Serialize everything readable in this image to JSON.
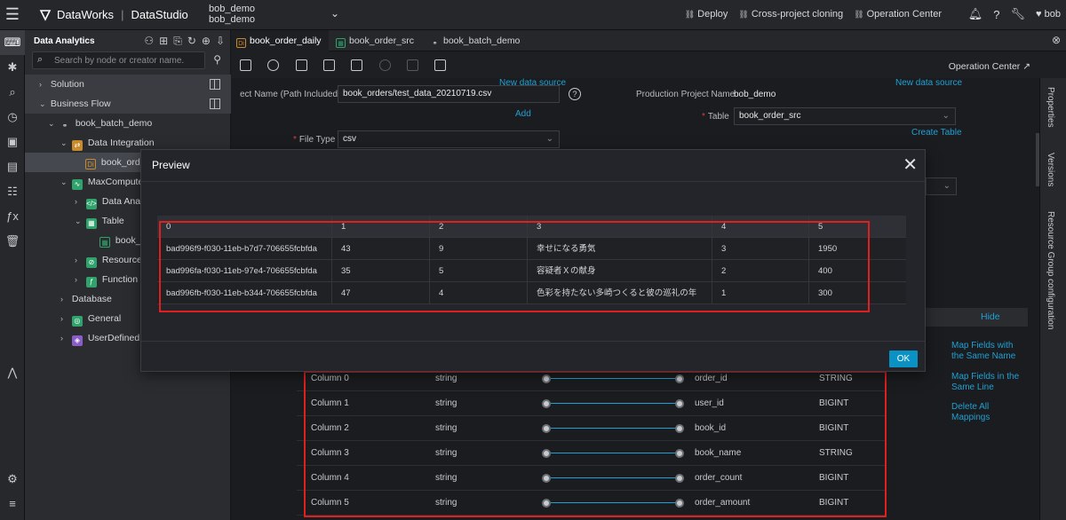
{
  "app": {
    "brand": "DataWorks",
    "module": "DataStudio",
    "workspace_line1": "bob_demo",
    "workspace_line2": "bob_demo"
  },
  "topnav": {
    "deploy": "Deploy",
    "cross_project": "Cross-project cloning",
    "operation_center": "Operation Center",
    "user": "bob"
  },
  "tree": {
    "title": "Data Analytics",
    "search_placeholder": "Search by node or creator name.",
    "solution": "Solution",
    "business_flow": "Business Flow",
    "flow_name": "book_batch_demo",
    "data_integration": "Data Integration",
    "sync_node": "book_order_daily",
    "maxcompute": "MaxCompute",
    "data_analytics": "Data Analytics",
    "table": "Table",
    "table_item": "book_order_src",
    "resource": "Resource",
    "function": "Function",
    "database": "Database",
    "general": "General",
    "userdefined": "UserDefined"
  },
  "tabs": [
    {
      "label": "book_order_daily"
    },
    {
      "label": "book_order_src"
    },
    {
      "label": "book_batch_demo"
    }
  ],
  "toolbar": {
    "operation_center": "Operation Center ↗"
  },
  "right_tabs": {
    "properties": "Properties",
    "versions": "Versions",
    "resource_group": "Resource Group configuration"
  },
  "form": {
    "object_label": "ect Name (Path Included)",
    "object_value": "book_orders/test_data_20210719.csv",
    "new_source_left": "New data source",
    "add": "Add",
    "file_type_label": "File Type",
    "file_type_value": "csv",
    "prod_project_label": "Production Project Name",
    "prod_project_value": "bob_demo",
    "new_source_right": "New data source",
    "table_label": "Table",
    "table_value": "book_order_src",
    "create_table": "Create Table",
    "hide": "Hide"
  },
  "mapping": {
    "rows": [
      {
        "src": "Column 0",
        "src_type": "string",
        "dst": "order_id",
        "dst_type": "STRING"
      },
      {
        "src": "Column 1",
        "src_type": "string",
        "dst": "user_id",
        "dst_type": "BIGINT"
      },
      {
        "src": "Column 2",
        "src_type": "string",
        "dst": "book_id",
        "dst_type": "BIGINT"
      },
      {
        "src": "Column 3",
        "src_type": "string",
        "dst": "book_name",
        "dst_type": "STRING"
      },
      {
        "src": "Column 4",
        "src_type": "string",
        "dst": "order_count",
        "dst_type": "BIGINT"
      },
      {
        "src": "Column 5",
        "src_type": "string",
        "dst": "order_amount",
        "dst_type": "BIGINT"
      }
    ],
    "map_same_name": "Map Fields with the Same Name",
    "map_same_line": "Map Fields in the Same Line",
    "delete_all": "Delete All Mappings"
  },
  "preview": {
    "title": "Preview",
    "ok": "OK",
    "headers": [
      "0",
      "1",
      "2",
      "3",
      "4",
      "5"
    ],
    "rows": [
      [
        "bad996f9-f030-11eb-b7d7-706655fcbfda",
        "43",
        "9",
        "幸せになる勇気",
        "3",
        "1950"
      ],
      [
        "bad996fa-f030-11eb-97e4-706655fcbfda",
        "35",
        "5",
        "容疑者Ｘの献身",
        "2",
        "400"
      ],
      [
        "bad996fb-f030-11eb-b344-706655fcbfda",
        "47",
        "4",
        "色彩を持たない多崎つくると彼の巡礼の年",
        "1",
        "300"
      ]
    ]
  },
  "colors": {
    "accent": "#0a92c4",
    "link": "#1fa0d4",
    "highlight": "#e01f1f"
  }
}
